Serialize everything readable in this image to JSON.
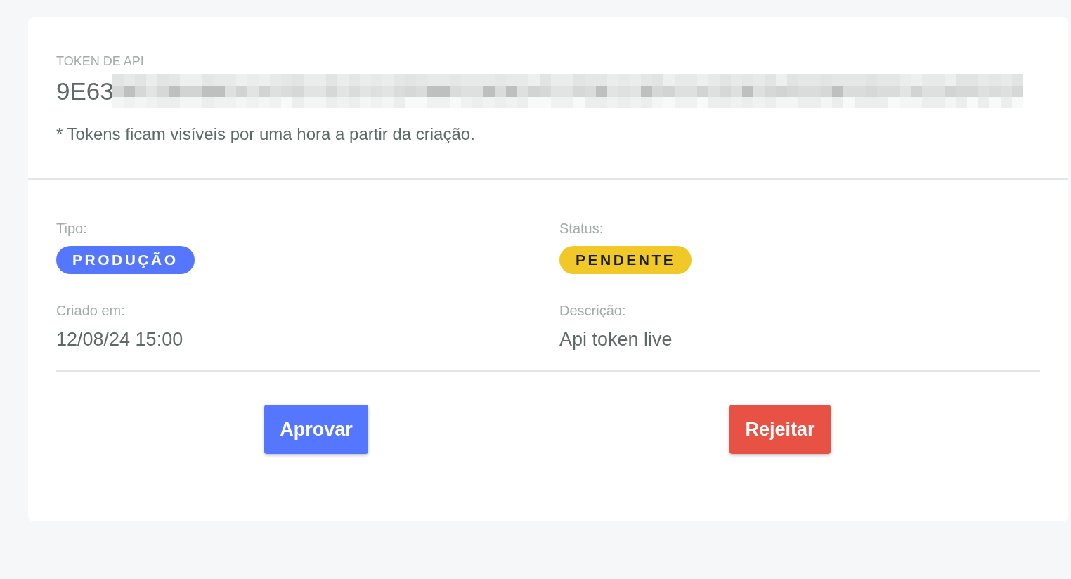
{
  "card": {
    "token": {
      "label": "TOKEN DE API",
      "value": "9E63",
      "redacted": true
    },
    "note": "* Tokens ficam visíveis por uma hora a partir da criação.",
    "details": [
      {
        "label": "Tipo:",
        "kind": "badge",
        "value": "PRODUÇÃO",
        "color": "#5577ff"
      },
      {
        "label": "Status:",
        "kind": "badge",
        "value": "PENDENTE",
        "color": "#f0c929"
      },
      {
        "label": "Criado em:",
        "kind": "text",
        "value": "12/08/24 15:00"
      },
      {
        "label": "Descrição:",
        "kind": "text",
        "value": "Api token live"
      }
    ],
    "actions": [
      {
        "label": "Aprovar",
        "kind": "approve"
      },
      {
        "label": "Rejeitar",
        "kind": "reject"
      }
    ]
  }
}
